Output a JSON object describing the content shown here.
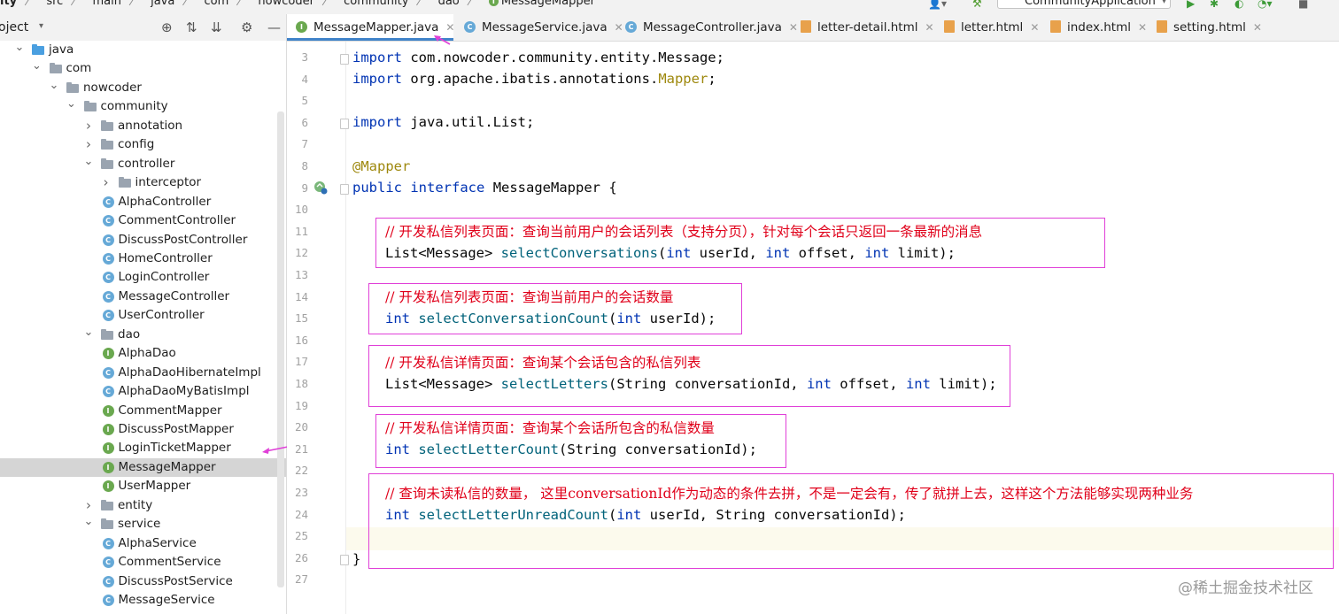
{
  "breadcrumbs": [
    "ity",
    "src",
    "main",
    "java",
    "com",
    "nowcoder",
    "community",
    "dao",
    "MessageMapper"
  ],
  "run_config": "CommunityApplication",
  "project_panel": {
    "title": "oject"
  },
  "tree": [
    {
      "label": "java",
      "kind": "java-folder",
      "expanded": true
    },
    {
      "label": "com",
      "kind": "package",
      "expanded": true
    },
    {
      "label": "nowcoder",
      "kind": "package",
      "expanded": true
    },
    {
      "label": "community",
      "kind": "package",
      "expanded": true
    },
    {
      "label": "annotation",
      "kind": "package",
      "expanded": false
    },
    {
      "label": "config",
      "kind": "package",
      "expanded": false
    },
    {
      "label": "controller",
      "kind": "package",
      "expanded": true
    },
    {
      "label": "interceptor",
      "kind": "package",
      "expanded": false
    },
    {
      "label": "AlphaController",
      "kind": "class"
    },
    {
      "label": "CommentController",
      "kind": "class"
    },
    {
      "label": "DiscussPostController",
      "kind": "class"
    },
    {
      "label": "HomeController",
      "kind": "class"
    },
    {
      "label": "LoginController",
      "kind": "class"
    },
    {
      "label": "MessageController",
      "kind": "class"
    },
    {
      "label": "UserController",
      "kind": "class"
    },
    {
      "label": "dao",
      "kind": "package",
      "expanded": true
    },
    {
      "label": "AlphaDao",
      "kind": "interface"
    },
    {
      "label": "AlphaDaoHibernateImpl",
      "kind": "class"
    },
    {
      "label": "AlphaDaoMyBatisImpl",
      "kind": "class"
    },
    {
      "label": "CommentMapper",
      "kind": "interface"
    },
    {
      "label": "DiscussPostMapper",
      "kind": "interface"
    },
    {
      "label": "LoginTicketMapper",
      "kind": "interface"
    },
    {
      "label": "MessageMapper",
      "kind": "interface",
      "selected": true
    },
    {
      "label": "UserMapper",
      "kind": "interface"
    },
    {
      "label": "entity",
      "kind": "package",
      "expanded": false
    },
    {
      "label": "service",
      "kind": "package",
      "expanded": true
    },
    {
      "label": "AlphaService",
      "kind": "class"
    },
    {
      "label": "CommentService",
      "kind": "class"
    },
    {
      "label": "DiscussPostService",
      "kind": "class"
    },
    {
      "label": "MessageService",
      "kind": "class"
    }
  ],
  "tabs": [
    {
      "label": "MessageMapper.java",
      "icon": "interface",
      "active": true
    },
    {
      "label": "MessageService.java",
      "icon": "class"
    },
    {
      "label": "MessageController.java",
      "icon": "class"
    },
    {
      "label": "letter-detail.html",
      "icon": "html"
    },
    {
      "label": "letter.html",
      "icon": "html"
    },
    {
      "label": "index.html",
      "icon": "html"
    },
    {
      "label": "setting.html",
      "icon": "html"
    }
  ],
  "code": {
    "line_numbers": [
      "3",
      "4",
      "5",
      "6",
      "7",
      "8",
      "9",
      "10",
      "11",
      "12",
      "13",
      "14",
      "15",
      "16",
      "17",
      "18",
      "19",
      "20",
      "21",
      "22",
      "23",
      "24",
      "25",
      "26",
      "27"
    ],
    "import1_pkg": "com.nowcoder.community.entity.Message;",
    "import2_pkg": "org.apache.ibatis.annotations.",
    "import2_ann": "Mapper",
    "import3_pkg": "java.util.List;",
    "kw_import": "import",
    "annotation": "@Mapper",
    "kw_public": "public",
    "kw_interface": "interface",
    "interface_name": "MessageMapper {",
    "closing_brace": "}",
    "comment1": "// 开发私信列表页面：查询当前用户的会话列表（支持分页），针对每个会话只返回一条最新的消息",
    "comment2": "// 开发私信列表页面：查询当前用户的会话数量",
    "comment3": "// 开发私信详情页面：查询某个会话包含的私信列表",
    "comment4": "// 开发私信详情页面：查询某个会话所包含的私信数量",
    "comment5": "// 查询未读私信的数量， 这里conversationId作为动态的条件去拼，不是一定会有，传了就拼上去，这样这个方法能够实现两种业务",
    "m1_ret": "List<Message> ",
    "m1_name": "selectConversations",
    "m1_a": "(",
    "m1_int": "int",
    "m1_b": " userId, ",
    "m1_int2": "int",
    "m1_c": " offset, ",
    "m1_int3": "int",
    "m1_d": " limit);",
    "m2_int": "int",
    "m2_name": "selectConversationCount",
    "m2_a": "(",
    "m2_int2": "int",
    "m2_b": " userId);",
    "m3_ret": "List<Message> ",
    "m3_name": "selectLetters",
    "m3_a": "(String conversationId, ",
    "m3_int": "int",
    "m3_b": " offset, ",
    "m3_int2": "int",
    "m3_c": " limit);",
    "m4_int": "int",
    "m4_name": "selectLetterCount",
    "m4_a": "(String conversationId);",
    "m5_int": "int",
    "m5_name": "selectLetterUnreadCount",
    "m5_a": "(",
    "m5_int2": "int",
    "m5_b": " userId, String conversationId);"
  },
  "colors": {
    "annotation_box": "#e040d8",
    "comment": "#e0001a",
    "keyword": "#0033b3",
    "method": "#00627a",
    "annotation": "#9e880d"
  },
  "watermark": "@稀土掘金技术社区"
}
